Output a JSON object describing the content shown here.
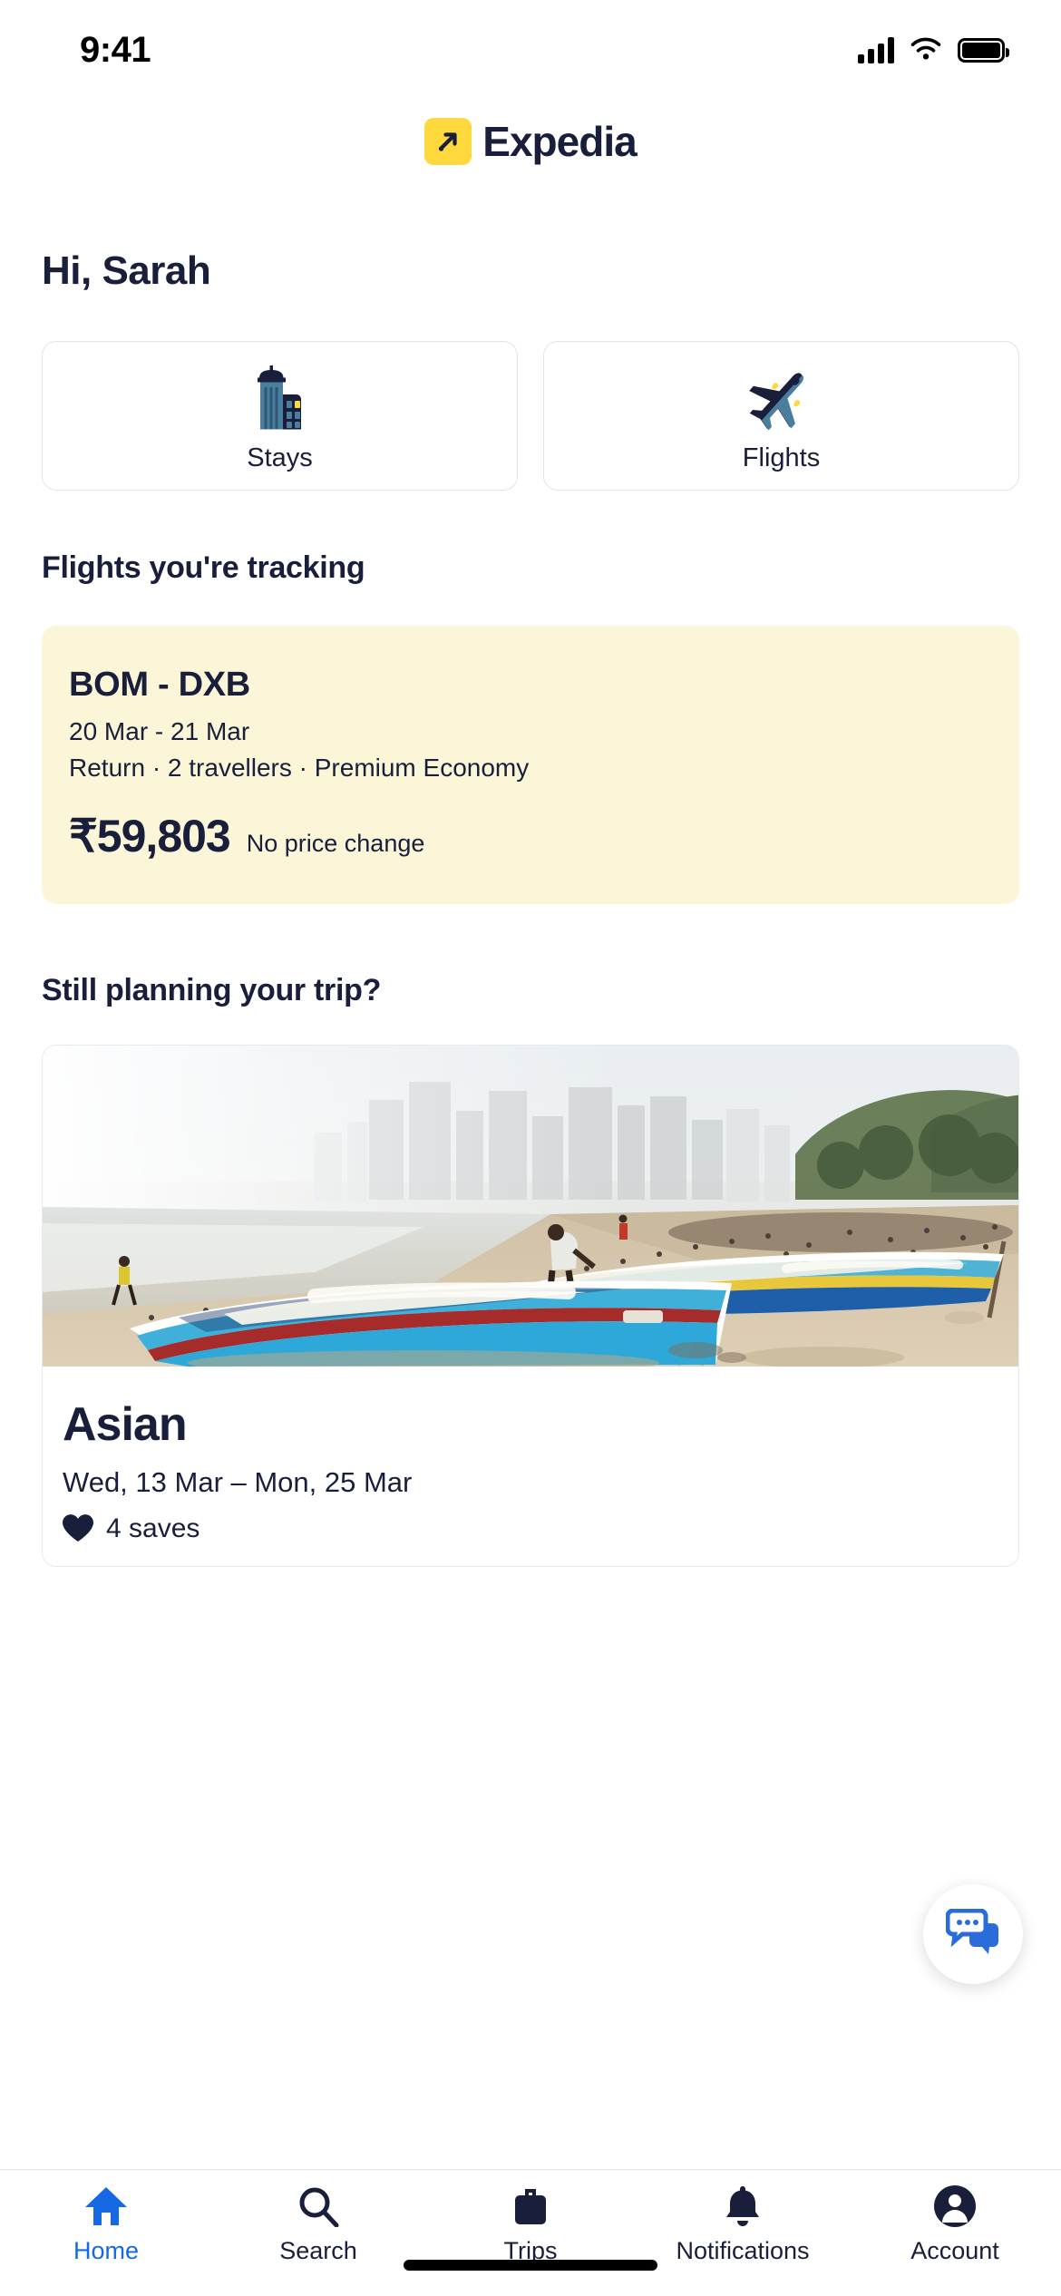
{
  "status_bar": {
    "time": "9:41",
    "signal_icon": "cellular-signal-icon",
    "wifi_icon": "wifi-icon",
    "battery_icon": "battery-icon"
  },
  "brand": {
    "logo_icon": "expedia-logo-icon",
    "name": "Expedia",
    "mark_color": "#FFD83D"
  },
  "greeting": "Hi, Sarah",
  "quick_actions": [
    {
      "label": "Stays",
      "icon": "hotel-building-icon"
    },
    {
      "label": "Flights",
      "icon": "airplane-icon"
    }
  ],
  "tracking": {
    "section_title": "Flights you're tracking",
    "card_bg": "#FCF6D9",
    "route": "BOM - DXB",
    "dates": "20 Mar - 21 Mar",
    "meta": "Return · 2 travellers · Premium Economy",
    "price": "₹59,803",
    "price_change": "No price change"
  },
  "planning": {
    "section_title": "Still planning your trip?",
    "trip": {
      "image_alt": "beach-with-fishing-boats-photo",
      "title": "Asian",
      "dates": "Wed, 13 Mar – Mon, 25 Mar",
      "saves_icon": "heart-icon",
      "saves": "4 saves"
    }
  },
  "chat_fab": {
    "icon": "chat-bubbles-icon",
    "color": "#2B6CDB"
  },
  "bottom_nav": {
    "active_color": "#1668E3",
    "items": [
      {
        "label": "Home",
        "icon": "home-icon",
        "active": true
      },
      {
        "label": "Search",
        "icon": "search-icon",
        "active": false
      },
      {
        "label": "Trips",
        "icon": "suitcase-icon",
        "active": false
      },
      {
        "label": "Notifications",
        "icon": "bell-icon",
        "active": false
      },
      {
        "label": "Account",
        "icon": "account-avatar-icon",
        "active": false
      }
    ]
  }
}
